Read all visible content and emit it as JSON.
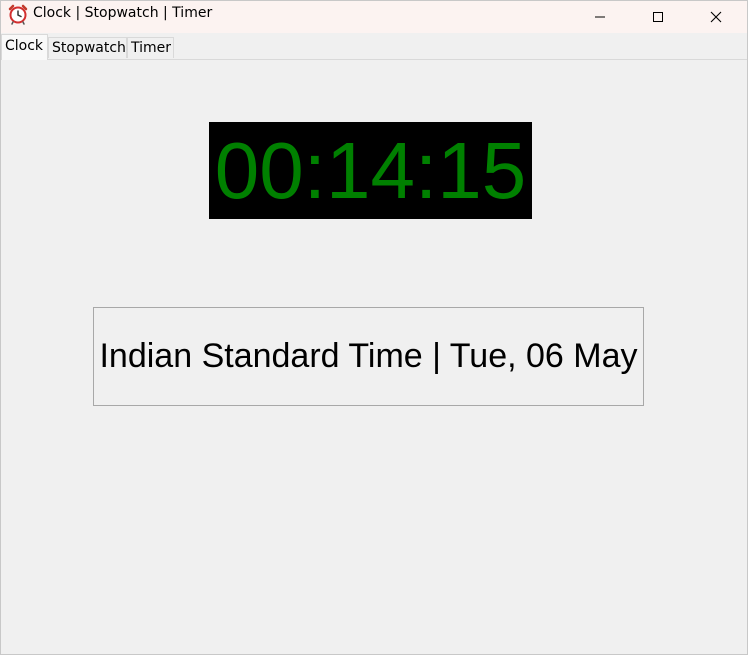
{
  "window": {
    "title": "Clock | Stopwatch | Timer",
    "icon": "alarm-clock-icon",
    "controls": {
      "minimize": "minimize-icon",
      "maximize": "maximize-icon",
      "close": "close-icon"
    }
  },
  "tabs": [
    {
      "label": "Clock",
      "active": true
    },
    {
      "label": "Stopwatch",
      "active": false
    },
    {
      "label": "Timer",
      "active": false
    }
  ],
  "clock": {
    "time": "00:14:15",
    "timezone_date": "Indian Standard Time | Tue, 06 May"
  },
  "colors": {
    "display_background": "#000000",
    "display_digits": "#008000",
    "titlebar": "#fcf3f1",
    "window_background": "#f0f0f0"
  }
}
